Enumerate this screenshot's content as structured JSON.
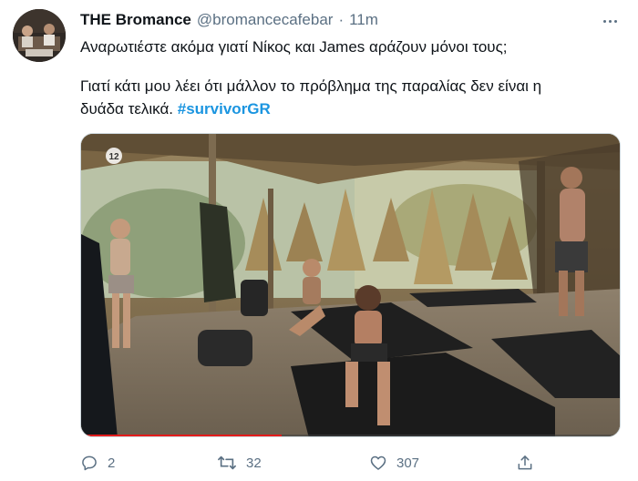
{
  "tweet": {
    "author_name": "THE Bromance",
    "author_handle": "@bromancecafebar",
    "separator": "·",
    "time": "11m",
    "line1": "Αναρωτιέστε ακόμα γιατί Νίκος και James αράζουν μόνοι τους;",
    "line2": "Γιατί κάτι μου λέει ότι μάλλον το πρόβλημα της παραλίας δεν είναι η",
    "line3": "δυάδα τελικά.",
    "hashtag": "#survivorGR"
  },
  "media": {
    "channel_logo": "12"
  },
  "actions": {
    "reply_count": "2",
    "retweet_count": "32",
    "like_count": "307"
  },
  "icons": {
    "more": "more-horizontal-icon",
    "reply": "reply-icon",
    "retweet": "retweet-icon",
    "like": "heart-icon",
    "share": "share-icon"
  },
  "colors": {
    "hashtag": "#1b95e0",
    "secondary_text": "#5b7083",
    "primary_text": "#0f1419"
  }
}
